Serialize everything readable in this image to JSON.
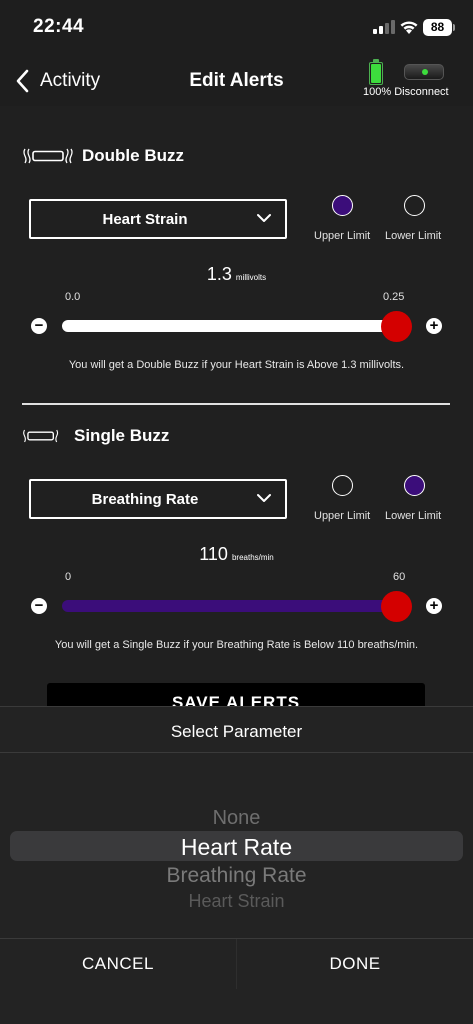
{
  "status_bar": {
    "time": "22:44",
    "battery": "88"
  },
  "nav": {
    "back_label": "Activity",
    "title": "Edit Alerts",
    "device_battery": "100%",
    "device_action": "Disconnect"
  },
  "double_buzz": {
    "title": "Double Buzz",
    "parameter": "Heart Strain",
    "upper_label": "Upper Limit",
    "lower_label": "Lower Limit",
    "selected_limit": "Upper Limit",
    "value": "1.3",
    "unit": "millivolts",
    "min": "0.0",
    "max": "0.25",
    "slider_level": 1.0,
    "hint": "You will get a Double Buzz if your Heart Strain is Above 1.3 millivolts."
  },
  "single_buzz": {
    "title": "Single Buzz",
    "parameter": "Breathing Rate",
    "upper_label": "Upper Limit",
    "lower_label": "Lower Limit",
    "selected_limit": "Lower Limit",
    "value": "110",
    "unit": "breaths/min",
    "min": "0",
    "max": "60",
    "slider_level": 1.0,
    "hint": "You will get a Single Buzz if your Breathing Rate is Below 110 breaths/min."
  },
  "save_button": {
    "label": "SAVE ALERTS"
  },
  "picker": {
    "title": "Select Parameter",
    "options": [
      "None",
      "Heart Rate",
      "Breathing Rate",
      "Heart Strain"
    ],
    "selected": "Heart Rate",
    "cancel": "CANCEL",
    "done": "DONE"
  },
  "colors": {
    "accent_purple": "#3b0d7a",
    "thumb_red": "#d40000",
    "background": "#1e1e1e"
  }
}
